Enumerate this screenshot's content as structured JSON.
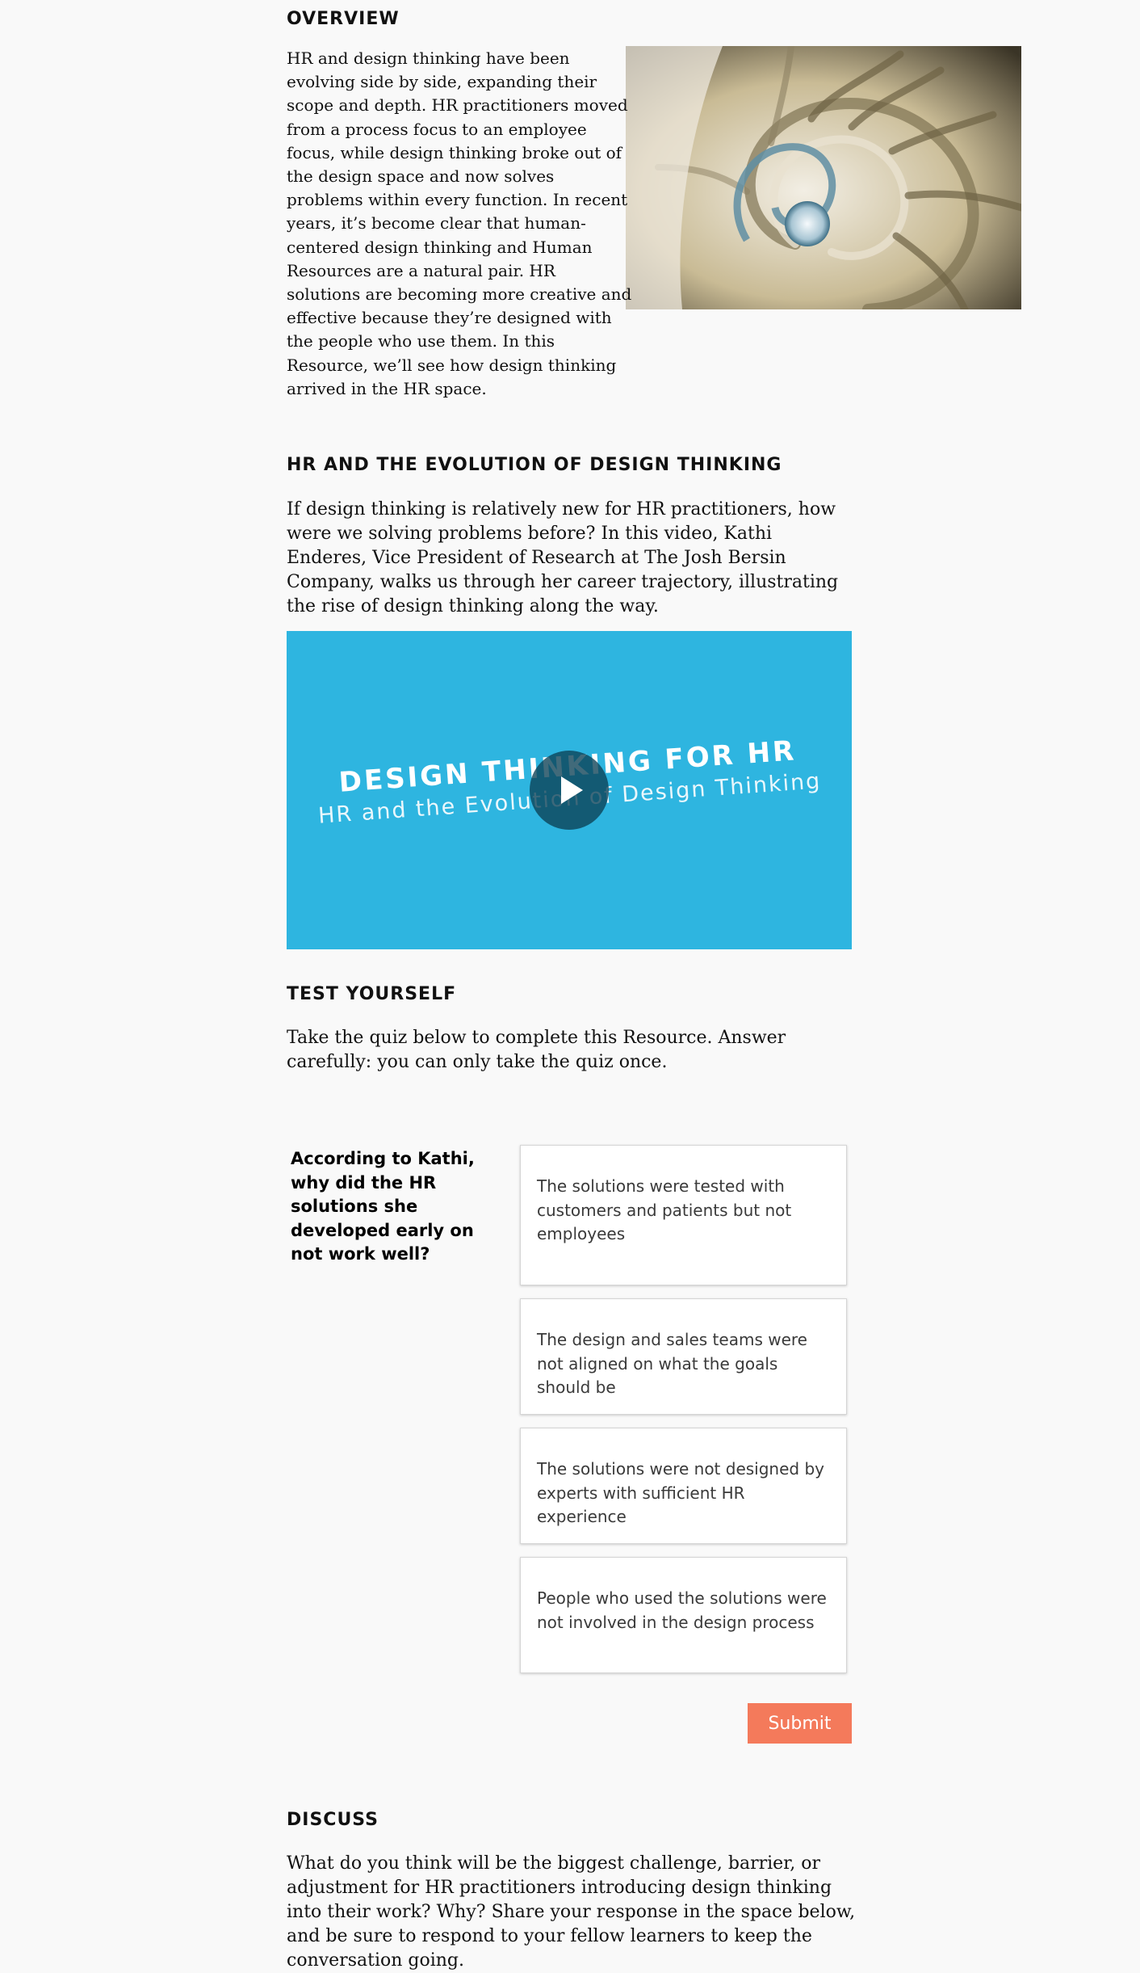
{
  "overview": {
    "heading": "OVERVIEW",
    "text": "HR and design thinking have been evolving side by side, expanding their scope and depth. HR practitioners moved from a process focus to an employee focus, while design thinking broke out of the design space and now solves problems within every function. In recent years, it’s become clear that human-centered design thinking and Human Resources are a natural pair. HR solutions are becoming more creative and effective because they’re designed with the people who use them. In this Resource, we’ll see how design thinking arrived in the HR space."
  },
  "evolution": {
    "heading": "HR AND THE EVOLUTION OF DESIGN THINKING",
    "text": "If design thinking is relatively new for HR practitioners, how were we solving problems before? In this video, Kathi Enderes, Vice President of Research at The Josh Bersin Company, walks us through her career trajectory, illustrating the rise of design thinking along the way."
  },
  "video": {
    "title": "DESIGN THINKING FOR HR",
    "subtitle": "HR and the Evolution of Design Thinking",
    "background_color": "#2eb5e0",
    "icon": "play-icon"
  },
  "test": {
    "heading": "TEST YOURSELF",
    "text": "Take the quiz below to complete this Resource. Answer carefully: you can only take the quiz once."
  },
  "quiz": {
    "question": "According to Kathi, why did the HR solutions she developed early on not work well?",
    "options": [
      "The solutions were tested with customers and patients but not employees",
      "The design and sales teams were not aligned on what the goals should be",
      "The solutions were not designed by experts with sufficient HR experience",
      "People who used the solutions were not involved in the design process"
    ],
    "submit_label": "Submit",
    "submit_color": "#f47a5b"
  },
  "discuss": {
    "heading": "DISCUSS",
    "text": "What do you think will be the biggest challenge, barrier, or adjustment for HR practitioners introducing design thinking into their work? Why? Share your response in the space below, and be sure to respond to your fellow learners to keep the conversation going."
  }
}
